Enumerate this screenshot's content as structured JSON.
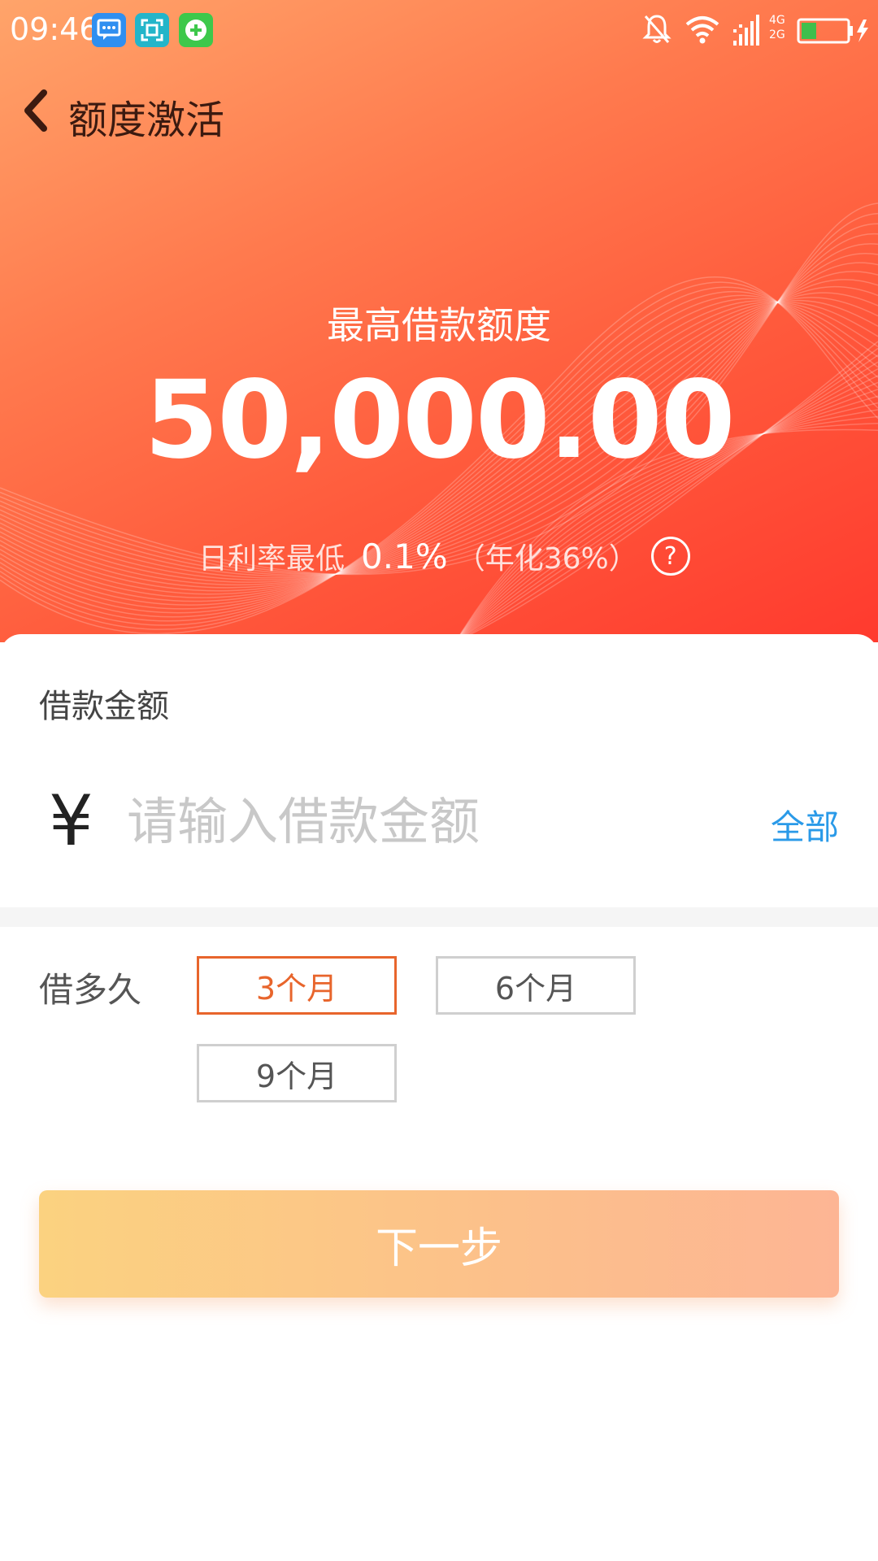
{
  "status_bar": {
    "time": "09:46",
    "network_top": "4G",
    "network_bottom": "2G"
  },
  "header": {
    "title": "额度激活"
  },
  "hero": {
    "limit_label": "最高借款额度",
    "limit_amount": "50,000.00",
    "rate_prefix": "日利率最低",
    "rate_value": "0.1%",
    "rate_annual": "（年化36%）",
    "help_symbol": "?"
  },
  "form": {
    "amount_label": "借款金额",
    "currency_symbol": "¥",
    "amount_placeholder": "请输入借款金额",
    "all_label": "全部",
    "term_label": "借多久",
    "term_options": [
      {
        "label": "3个月",
        "selected": true
      },
      {
        "label": "6个月",
        "selected": false
      },
      {
        "label": "9个月",
        "selected": false
      }
    ],
    "next_label": "下一步"
  },
  "colors": {
    "accent": "#e8652c",
    "link": "#2a9ae8",
    "hero_start": "#ffa46a",
    "hero_end": "#ff3a2e"
  },
  "icons": [
    "message-icon",
    "scan-icon",
    "plus-circle-icon",
    "bell-off-icon",
    "wifi-icon",
    "signal-icon",
    "battery-icon",
    "back-chevron-icon",
    "help-icon"
  ]
}
